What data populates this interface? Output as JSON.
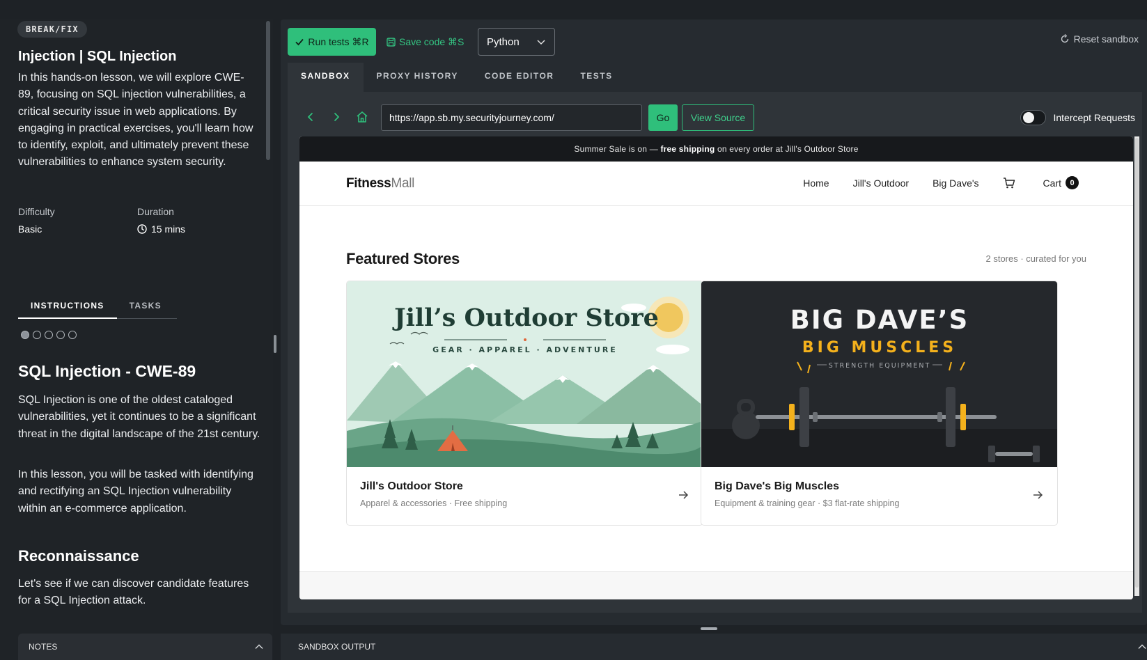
{
  "lesson": {
    "badge": "BREAK/FIX",
    "title": "Injection | SQL Injection",
    "description": "In this hands-on lesson, we will explore CWE-89, focusing on SQL injection vulnerabilities, a critical security issue in web applications. By engaging in practical exercises, you'll learn how to identify, exploit, and ultimately prevent these vulnerabilities to enhance system security.",
    "difficulty_label": "Difficulty",
    "difficulty_value": "Basic",
    "duration_label": "Duration",
    "duration_value": "15 mins"
  },
  "left_tabs": [
    "INSTRUCTIONS",
    "TASKS"
  ],
  "steps": {
    "total": 5,
    "current": 1
  },
  "content": {
    "heading": "SQL Injection - CWE-89",
    "para1": "SQL Injection is one of the oldest cataloged vulnerabilities, yet it continues to be a significant threat in the digital landscape of the 21st century.",
    "para2": "In this lesson, you will be tasked with identifying and rectifying an SQL Injection vulnerability within an e-commerce application.",
    "subheading": "Reconnaissance",
    "para3": "Let's see if we can discover candidate features for a SQL Injection attack."
  },
  "notes_label": "NOTES",
  "toolbar": {
    "run_label": "Run tests ⌘R",
    "save_label": "Save code ⌘S",
    "language": "Python",
    "reset_label": "Reset sandbox"
  },
  "main_tabs": [
    "SANDBOX",
    "PROXY HISTORY",
    "CODE EDITOR",
    "TESTS"
  ],
  "browser": {
    "url": "https://app.sb.my.securityjourney.com/",
    "go_label": "Go",
    "view_source_label": "View Source",
    "intercept_label": "Intercept Requests",
    "intercept_on": false
  },
  "site": {
    "promo_prefix": "Summer Sale is on — ",
    "promo_bold": "free shipping",
    "promo_suffix": " on every order at Jill's Outdoor Store",
    "logo_bold": "Fitness",
    "logo_thin": "Mall",
    "nav": [
      "Home",
      "Jill's Outdoor",
      "Big Dave's"
    ],
    "cart_label": "Cart",
    "cart_count": "0",
    "featured_title": "Featured Stores",
    "featured_meta": "2 stores · curated for you",
    "stores": [
      {
        "banner_title": "Jill’s Outdoor Store",
        "banner_tagline": "GEAR · APPAREL · ADVENTURE",
        "name": "Jill's Outdoor Store",
        "subtitle": "Apparel & accessories · Free shipping"
      },
      {
        "banner_title": "BIG DAVE’S",
        "banner_title2": "BIG MUSCLES",
        "banner_tagline": "STRENGTH EQUIPMENT",
        "name": "Big Dave's Big Muscles",
        "subtitle": "Equipment & training gear · $3 flat-rate shipping"
      }
    ]
  },
  "output_label": "SANDBOX OUTPUT",
  "colors": {
    "accent": "#2fbf7b",
    "panel": "#262b30",
    "background": "#1e2226"
  }
}
